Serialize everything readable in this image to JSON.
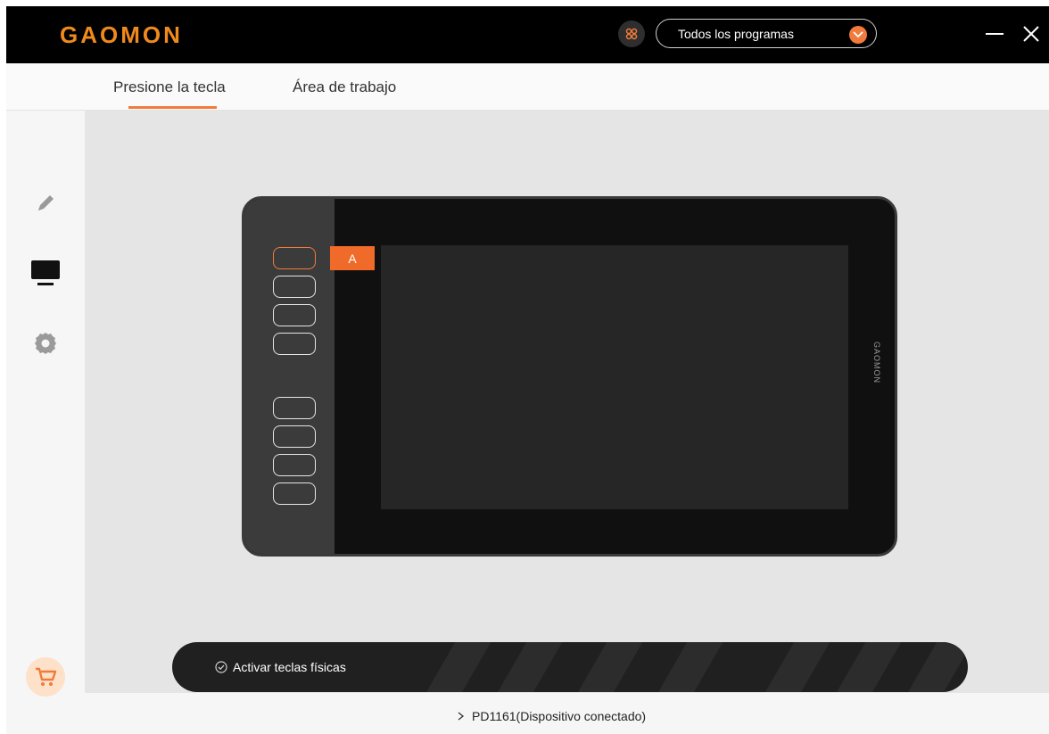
{
  "header": {
    "logo": "GAOMON",
    "program_select": {
      "value": "Todos los programas"
    }
  },
  "tabs": [
    {
      "label": "Presione la tecla"
    },
    {
      "label": "Área de trabajo"
    }
  ],
  "sidebar": {
    "items": [
      {
        "icon": "pen-icon"
      },
      {
        "icon": "monitor-icon"
      },
      {
        "icon": "gear-icon"
      }
    ],
    "cart_icon": "cart-icon"
  },
  "tablet": {
    "brand": "GAOMON",
    "keys_count": 8,
    "selected_key_label": "A"
  },
  "bottom_bar": {
    "activate_label": "Activar teclas físicas"
  },
  "status": {
    "device": "PD1161(Dispositivo conectado)"
  },
  "colors": {
    "accent": "#f07b3c",
    "topbar": "#000000",
    "tablet_body": "#101010"
  }
}
